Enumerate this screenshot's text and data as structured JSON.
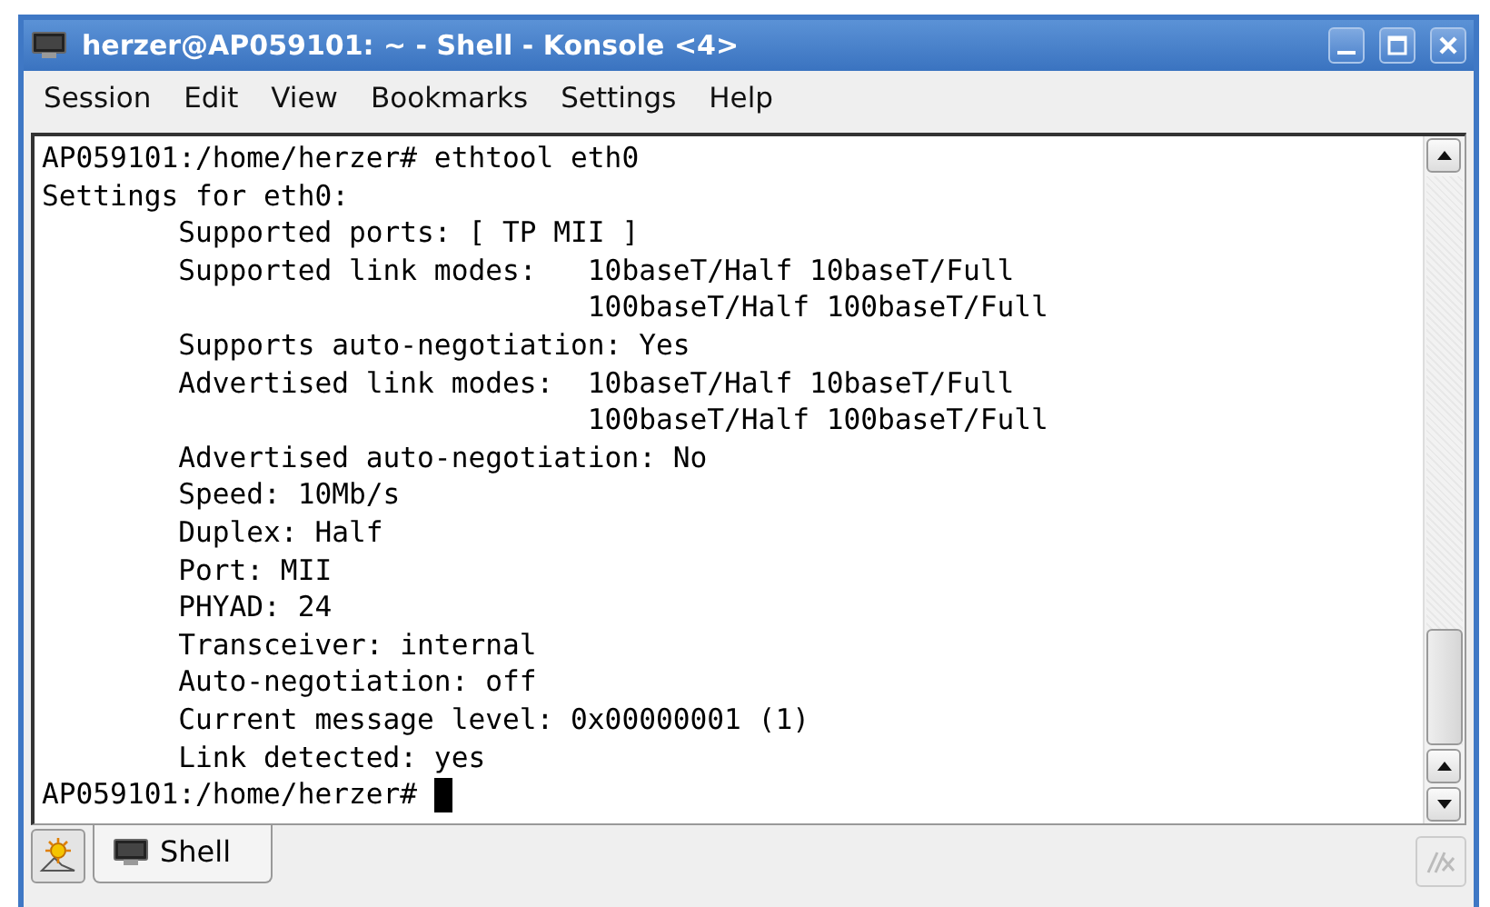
{
  "window": {
    "title": "herzer@AP059101: ~ - Shell - Konsole <4>"
  },
  "menu": [
    "Session",
    "Edit",
    "View",
    "Bookmarks",
    "Settings",
    "Help"
  ],
  "terminal": {
    "lines": [
      "AP059101:/home/herzer# ethtool eth0",
      "Settings for eth0:",
      "        Supported ports: [ TP MII ]",
      "        Supported link modes:   10baseT/Half 10baseT/Full",
      "                                100baseT/Half 100baseT/Full",
      "        Supports auto-negotiation: Yes",
      "        Advertised link modes:  10baseT/Half 10baseT/Full",
      "                                100baseT/Half 100baseT/Full",
      "        Advertised auto-negotiation: No",
      "        Speed: 10Mb/s",
      "        Duplex: Half",
      "        Port: MII",
      "        PHYAD: 24",
      "        Transceiver: internal",
      "        Auto-negotiation: off",
      "        Current message level: 0x00000001 (1)",
      "        Link detected: yes"
    ],
    "prompt": "AP059101:/home/herzer# "
  },
  "tabs": [
    {
      "label": "Shell",
      "selected": true
    }
  ]
}
